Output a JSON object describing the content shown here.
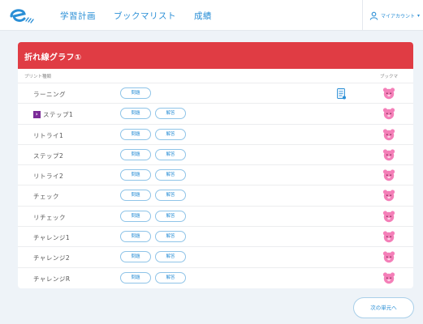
{
  "header": {
    "logo": "e-logo",
    "nav": [
      "学習計画",
      "ブックマリスト",
      "成績"
    ],
    "account_label": "マイアカウント",
    "account_caret": "▾",
    "account_icon": "user-icon"
  },
  "card": {
    "title": "折れ線グラフ①",
    "column_type": "プリント種類",
    "column_bookmark": "ブックマ",
    "question_label": "問題",
    "answer_label": "解答",
    "rows": [
      {
        "label": "ラーニング",
        "marker": ""
      },
      {
        "label": "ステップ1",
        "marker": "›"
      },
      {
        "label": "リトライ1",
        "marker": ""
      },
      {
        "label": "ステップ2",
        "marker": ""
      },
      {
        "label": "リトライ2",
        "marker": ""
      },
      {
        "label": "チェック",
        "marker": ""
      },
      {
        "label": "リチェック",
        "marker": ""
      },
      {
        "label": "チャレンジ1",
        "marker": ""
      },
      {
        "label": "チャレンジ2",
        "marker": ""
      },
      {
        "label": "チャレンジR",
        "marker": ""
      }
    ]
  },
  "footer": {
    "next_label": "次の単元へ"
  },
  "colors": {
    "accent": "#2b8fd6",
    "title_bar": "#e03c44",
    "marker": "#7b2b98",
    "bear": "#f47fb8"
  }
}
